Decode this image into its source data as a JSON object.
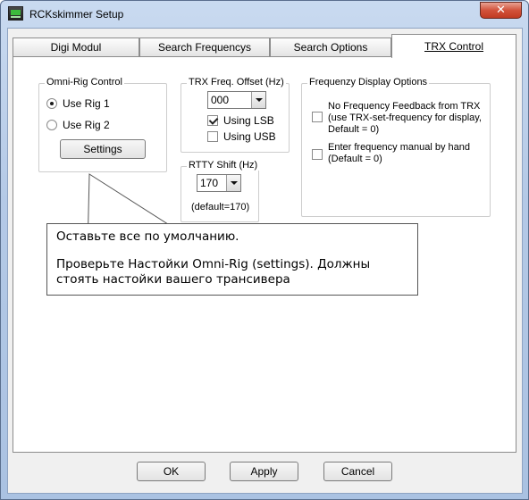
{
  "window": {
    "title": "RCKskimmer Setup",
    "close_glyph": "✕"
  },
  "tabs": [
    {
      "label": "Digi Modul",
      "active": false
    },
    {
      "label": "Search Frequencys",
      "active": false
    },
    {
      "label": "Search Options",
      "active": false
    },
    {
      "label": "TRX Control",
      "active": true
    }
  ],
  "omni_rig": {
    "legend": "Omni-Rig Control",
    "options": [
      {
        "label": "Use Rig 1",
        "selected": true
      },
      {
        "label": "Use Rig 2",
        "selected": false
      }
    ],
    "settings_label": "Settings"
  },
  "trx_offset": {
    "legend": "TRX Freq. Offset (Hz)",
    "value": "000",
    "using_lsb": {
      "label": "Using LSB",
      "checked": true
    },
    "using_usb": {
      "label": "Using USB",
      "checked": false
    }
  },
  "rtty_shift": {
    "legend": "RTTY Shift (Hz)",
    "value": "170",
    "default_note": "(default=170)"
  },
  "freq_display": {
    "legend": "Frequenzy Display Options",
    "option1": {
      "line1": "No Frequency Feedback from TRX",
      "line2": "(use TRX-set-frequency for display,",
      "line3": "Default = 0)",
      "checked": false
    },
    "option2": {
      "line1": "Enter frequency manual by hand",
      "line2": "(Default = 0)",
      "checked": false
    }
  },
  "callout": {
    "line1": "Оставьте все по умолчанию.",
    "line2": "Проверьте Настойки Omni-Rig (settings). Должны",
    "line3": "стоять настойки вашего трансивера"
  },
  "footer": {
    "ok_label": "OK",
    "apply_label": "Apply",
    "cancel_label": "Cancel"
  },
  "colors": {
    "title_bar": "#b4c9e6",
    "close_button": "#d2523b",
    "panel": "#ffffff",
    "dialog_bg": "#f0f0f0"
  }
}
